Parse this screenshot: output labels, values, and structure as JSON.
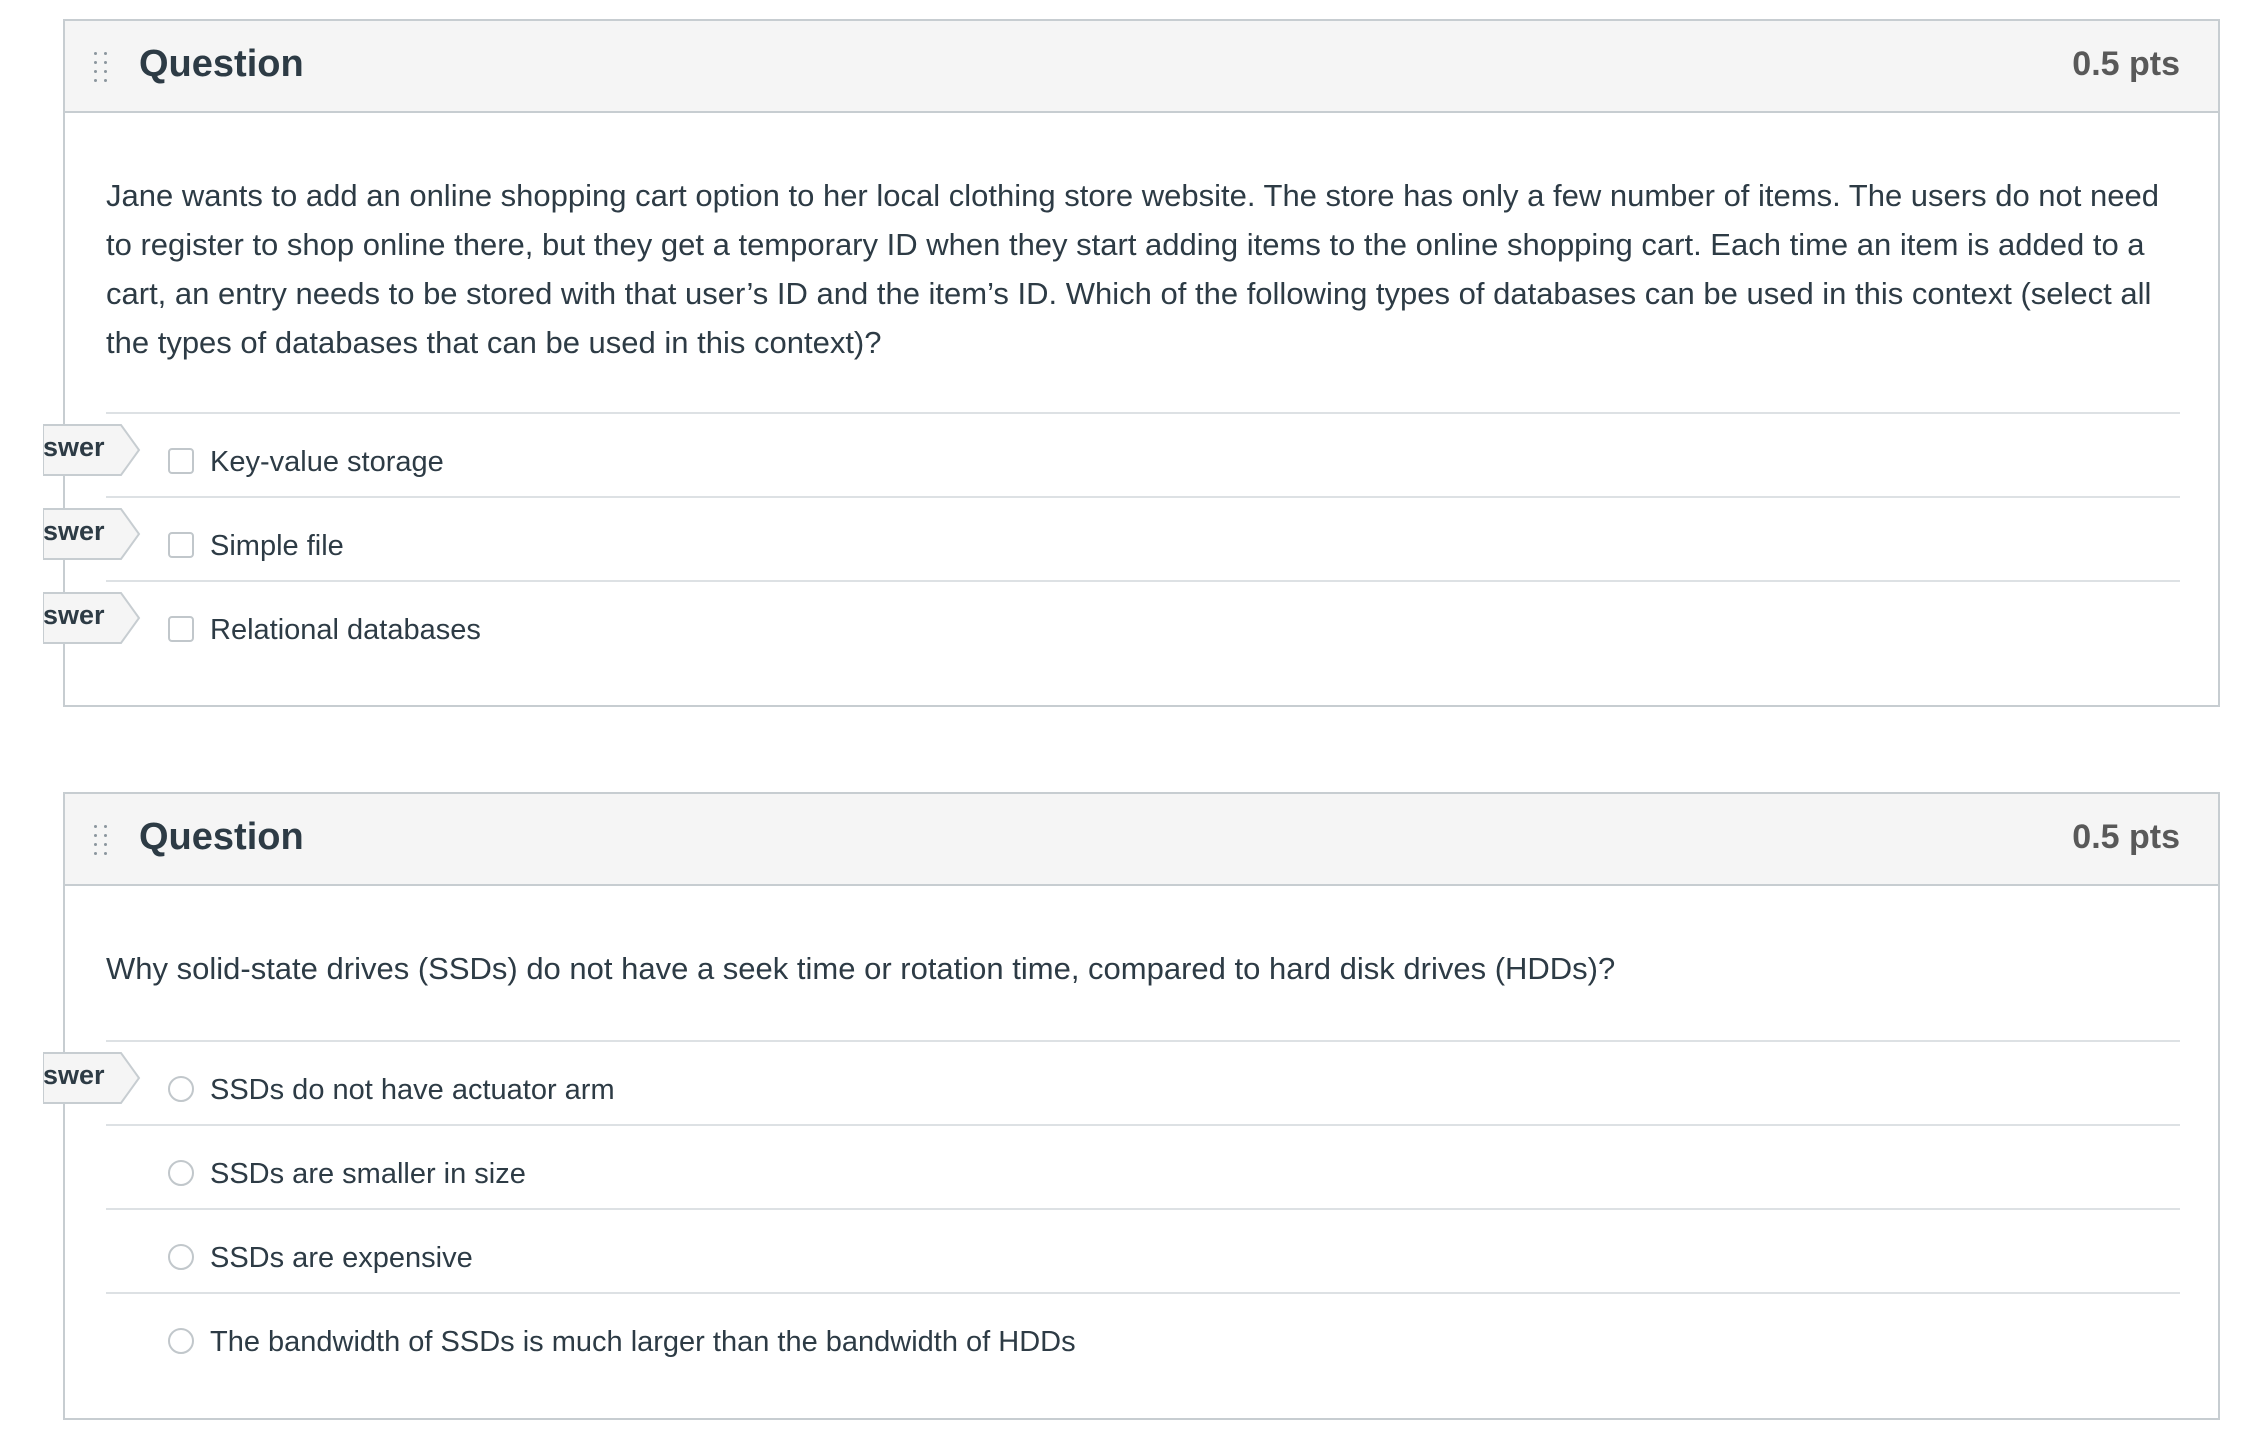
{
  "questions": [
    {
      "title": "Question",
      "points": "0.5 pts",
      "text": "Jane wants to add an online shopping cart option to her local clothing store website. The store has only a few number of items. The users do not need to register to shop online there, but they get a temporary ID when they start adding items to the online shopping cart. Each time an item is added to a cart, an entry needs to be stored with that user’s ID and the item’s ID. Which of the following types of databases can be used in this context (select all the types of databases that can be used in this context)?",
      "input_type": "checkbox",
      "answers": [
        {
          "label": "Key-value storage",
          "flag": "swer",
          "checked": false
        },
        {
          "label": "Simple file",
          "flag": "swer",
          "checked": false
        },
        {
          "label": "Relational databases",
          "flag": "swer",
          "checked": false
        }
      ]
    },
    {
      "title": "Question",
      "points": "0.5 pts",
      "text": "Why solid-state drives (SSDs) do not have a seek time or rotation time, compared to hard disk drives (HDDs)?",
      "input_type": "radio",
      "answers": [
        {
          "label": "SSDs do not have actuator arm",
          "flag": "swer",
          "checked": false
        },
        {
          "label": "SSDs are smaller in size",
          "flag": "",
          "checked": false
        },
        {
          "label": "SSDs are expensive",
          "flag": "",
          "checked": false
        },
        {
          "label": "The bandwidth of SSDs is much larger than the bandwidth of HDDs",
          "flag": "",
          "checked": false
        }
      ]
    }
  ],
  "colors": {
    "header_bg": "#f5f5f5",
    "border": "#c7cdd1",
    "text": "#2d3b45",
    "points": "#595959"
  },
  "icons": {
    "drag": "drag-handle-icon",
    "checkbox": "checkbox-icon",
    "radio": "radio-icon",
    "answer_flag": "answer-flag-icon"
  }
}
